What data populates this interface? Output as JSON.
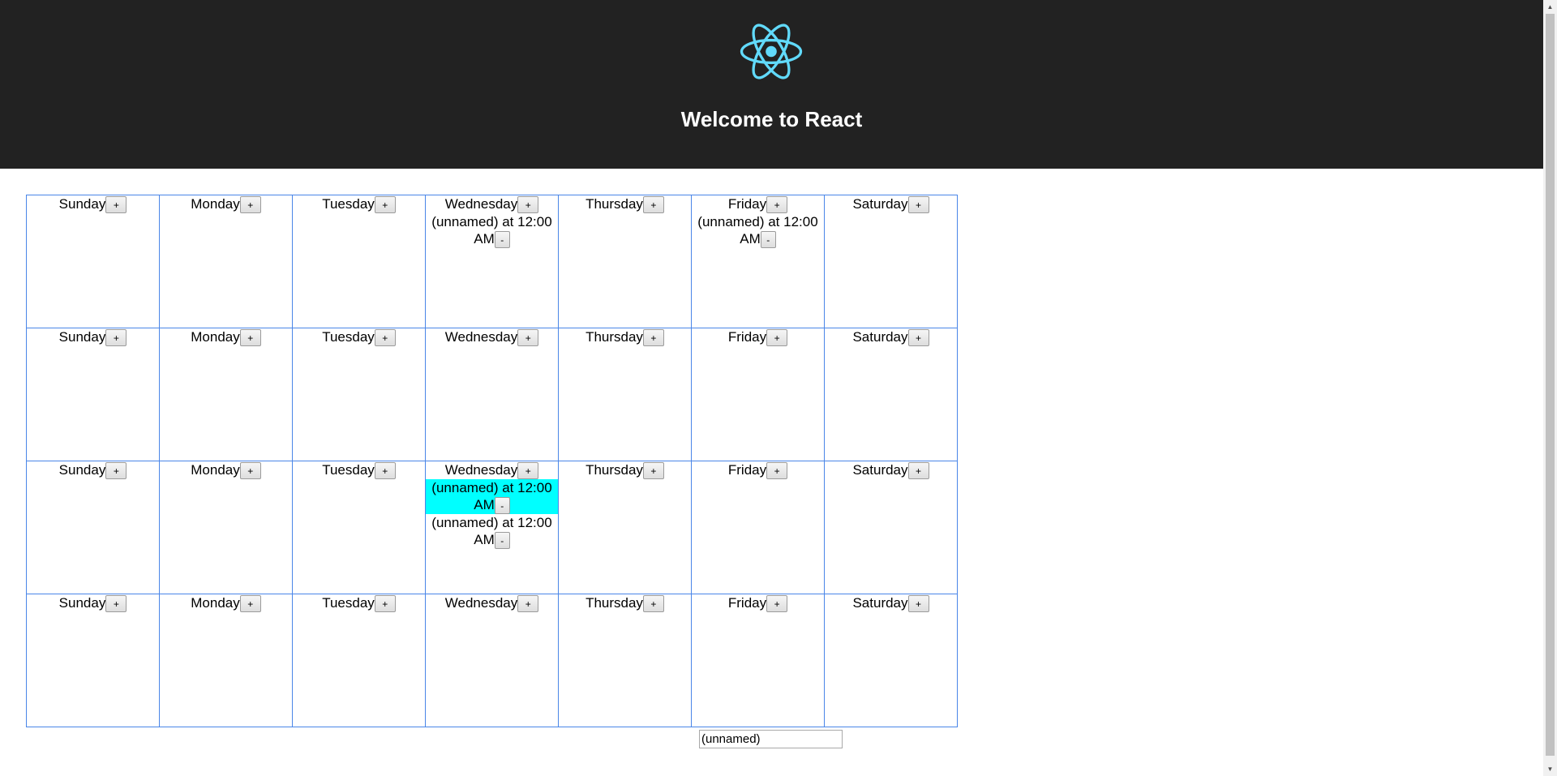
{
  "header": {
    "title": "Welcome to React",
    "logo_icon": "react-atom-icon",
    "logo_color": "#61dafb"
  },
  "calendar": {
    "add_label": "+",
    "remove_label": "-",
    "weeks": [
      {
        "days": [
          {
            "name": "Sunday",
            "events": []
          },
          {
            "name": "Monday",
            "events": []
          },
          {
            "name": "Tuesday",
            "events": []
          },
          {
            "name": "Wednesday",
            "events": [
              {
                "text": "(unnamed) at 12:00 AM",
                "selected": false
              }
            ]
          },
          {
            "name": "Thursday",
            "events": []
          },
          {
            "name": "Friday",
            "events": [
              {
                "text": "(unnamed) at 12:00 AM",
                "selected": false
              }
            ]
          },
          {
            "name": "Saturday",
            "events": []
          }
        ]
      },
      {
        "days": [
          {
            "name": "Sunday",
            "events": []
          },
          {
            "name": "Monday",
            "events": []
          },
          {
            "name": "Tuesday",
            "events": []
          },
          {
            "name": "Wednesday",
            "events": []
          },
          {
            "name": "Thursday",
            "events": []
          },
          {
            "name": "Friday",
            "events": []
          },
          {
            "name": "Saturday",
            "events": []
          }
        ]
      },
      {
        "days": [
          {
            "name": "Sunday",
            "events": []
          },
          {
            "name": "Monday",
            "events": []
          },
          {
            "name": "Tuesday",
            "events": []
          },
          {
            "name": "Wednesday",
            "events": [
              {
                "text": "(unnamed) at 12:00 AM",
                "selected": true
              },
              {
                "text": "(unnamed) at 12:00 AM",
                "selected": false
              }
            ]
          },
          {
            "name": "Thursday",
            "events": []
          },
          {
            "name": "Friday",
            "events": []
          },
          {
            "name": "Saturday",
            "events": []
          }
        ]
      },
      {
        "days": [
          {
            "name": "Sunday",
            "events": []
          },
          {
            "name": "Monday",
            "events": []
          },
          {
            "name": "Tuesday",
            "events": []
          },
          {
            "name": "Wednesday",
            "events": []
          },
          {
            "name": "Thursday",
            "events": []
          },
          {
            "name": "Friday",
            "events": []
          },
          {
            "name": "Saturday",
            "events": []
          }
        ]
      }
    ]
  },
  "editor": {
    "name_value": "(unnamed)"
  },
  "colors": {
    "header_bg": "#222222",
    "cell_border": "#4a86e8",
    "selected_event_bg": "#00ffff"
  }
}
